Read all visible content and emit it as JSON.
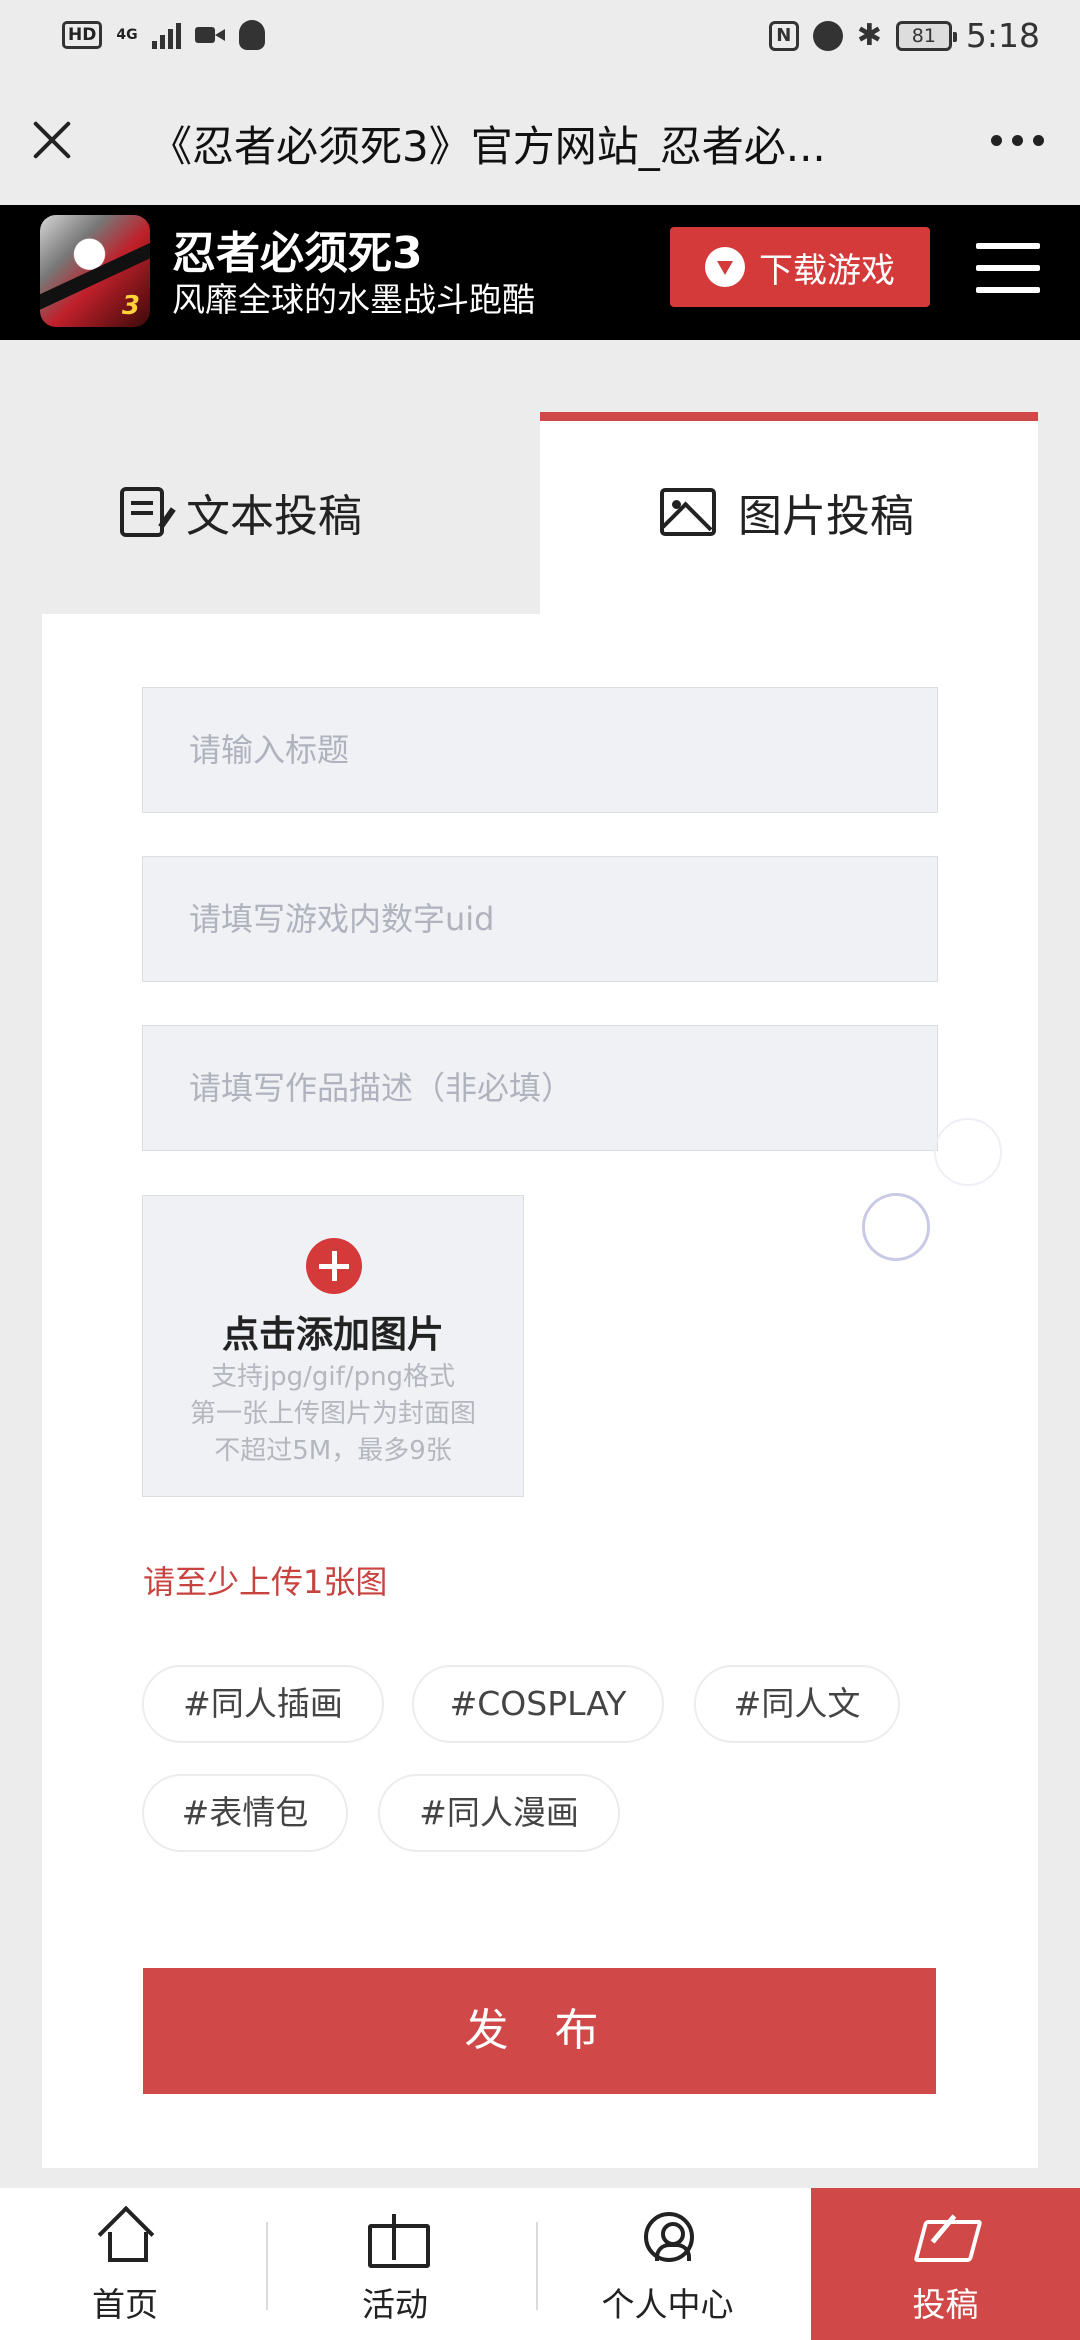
{
  "status_bar": {
    "hd": "HD",
    "network": "4G",
    "nfc": "N",
    "bluetooth": "✱",
    "battery": "81",
    "time": "5:18"
  },
  "title_bar": {
    "title": "《忍者必须死3》官方网站_忍者必..."
  },
  "site_header": {
    "logo_number": "3",
    "app_name": "忍者必须死3",
    "slogan": "风靡全球的水墨战斗跑酷",
    "download_label": "下载游戏"
  },
  "tabs": [
    {
      "label": "文本投稿",
      "icon": "doc-edit-icon",
      "active": false
    },
    {
      "label": "图片投稿",
      "icon": "image-icon",
      "active": true
    }
  ],
  "form": {
    "title_placeholder": "请输入标题",
    "uid_placeholder": "请填写游戏内数字uid",
    "desc_placeholder": "请填写作品描述（非必填）",
    "upload": {
      "title": "点击添加图片",
      "hints": [
        "支持jpg/gif/png格式",
        "第一张上传图片为封面图",
        "不超过5M，最多9张"
      ]
    },
    "error": "请至少上传1张图",
    "tags": [
      "#同人插画",
      "#COSPLAY",
      "#同人文",
      "#表情包",
      "#同人漫画"
    ],
    "publish_label": "发 布"
  },
  "bottom_nav": [
    {
      "label": "首页",
      "icon": "home-icon",
      "active": false
    },
    {
      "label": "活动",
      "icon": "gift-icon",
      "active": false
    },
    {
      "label": "个人中心",
      "icon": "user-icon",
      "active": false
    },
    {
      "label": "投稿",
      "icon": "post-icon",
      "active": true
    }
  ],
  "colors": {
    "accent": "#d04848",
    "header_bg": "#000000",
    "page_bg": "#ececec",
    "field_bg": "#f0f1f5"
  }
}
